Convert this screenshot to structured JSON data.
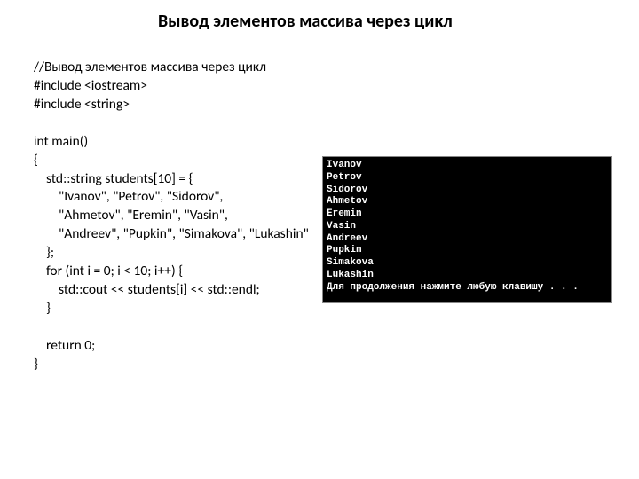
{
  "title": "Вывод элементов массива через цикл",
  "code": "//Вывод элементов массива через цикл\n#include <iostream>\n#include <string>\n\nint main()\n{\n    std::string students[10] = {\n        \"Ivanov\", \"Petrov\", \"Sidorov\",\n        \"Ahmetov\", \"Eremin\", \"Vasin\",\n        \"Andreev\", \"Pupkin\", \"Simakova\", \"Lukashin\"\n    };\n    for (int i = 0; i < 10; i++) {\n        std::cout << students[i] << std::endl;\n    }\n\n    return 0;\n}",
  "console": {
    "lines": [
      "Ivanov",
      "Petrov",
      "Sidorov",
      "Ahmetov",
      "Eremin",
      "Vasin",
      "Andreev",
      "Pupkin",
      "Simakova",
      "Lukashin",
      "Для продолжения нажмите любую клавишу . . ."
    ]
  }
}
